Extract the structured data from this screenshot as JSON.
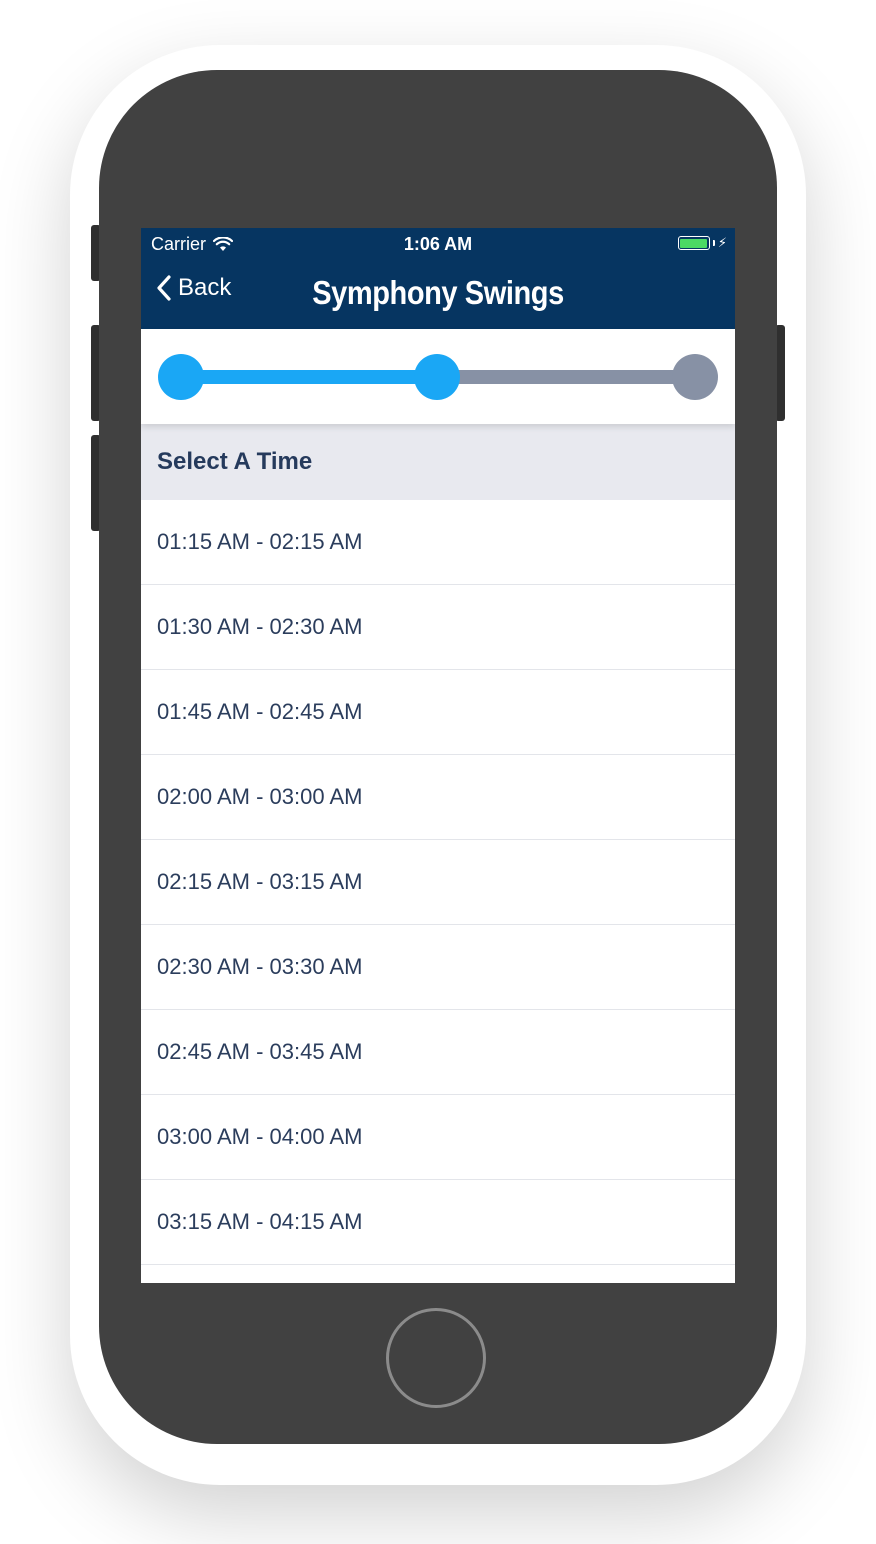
{
  "status_bar": {
    "carrier": "Carrier",
    "time": "1:06 AM",
    "battery_color": "#4cd964",
    "wifi_icon": "wifi-icon",
    "charging_icon": "bolt-icon"
  },
  "nav": {
    "back_label": "Back",
    "back_icon": "chevron-left-icon",
    "title": "Symphony Swings",
    "background": "#063561"
  },
  "stepper": {
    "total_steps": 3,
    "current_step": 2,
    "active_color": "#1aa7f5",
    "inactive_color": "#8791a5"
  },
  "section": {
    "title": "Select A Time"
  },
  "time_slots": [
    "01:15 AM - 02:15 AM",
    "01:30 AM - 02:30 AM",
    "01:45 AM - 02:45 AM",
    "02:00 AM - 03:00 AM",
    "02:15 AM - 03:15 AM",
    "02:30 AM - 03:30 AM",
    "02:45 AM - 03:45 AM",
    "03:00 AM - 04:00 AM",
    "03:15 AM - 04:15 AM"
  ]
}
